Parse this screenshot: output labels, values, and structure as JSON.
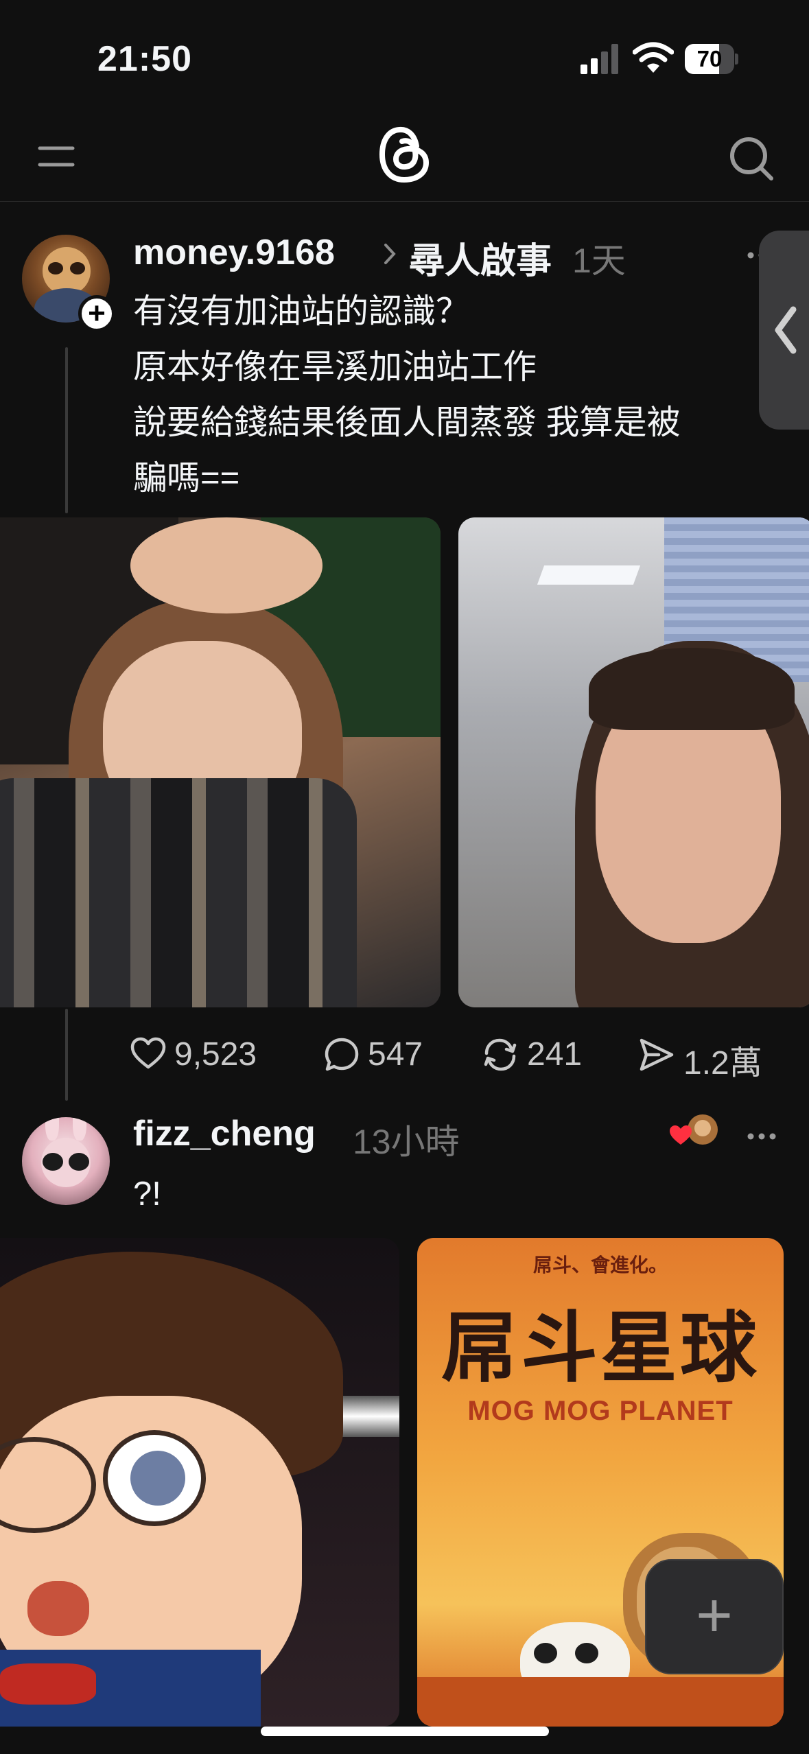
{
  "status_bar": {
    "time": "21:50",
    "battery": "70",
    "battery_level": 0.7
  },
  "top_nav": {
    "menu_icon": "menu-icon",
    "logo_icon": "threads-logo",
    "search_icon": "search-icon"
  },
  "posts": [
    {
      "username": "money.9168",
      "topic": "尋人啟事",
      "time": "1天",
      "lines": [
        "有沒有加油站的認識？",
        "原本好像在旱溪加油站工作",
        "說要給錢結果後面人間蒸發 我算是被",
        "騙嗎=="
      ],
      "likes": "9,523",
      "replies": "547",
      "reposts": "241",
      "shares": "1.2萬"
    },
    {
      "username": "fizz_cheng",
      "time": "13小時",
      "text": "?!",
      "poster": {
        "subtitle": "屌斗、會進化。",
        "title": "屌斗星球",
        "english": "MOG MOG PLANET"
      }
    }
  ],
  "compose_button": "+",
  "colors": {
    "background": "#101010",
    "text": "#f3f5f7",
    "muted": "#777777",
    "like_red": "#ff3040"
  }
}
